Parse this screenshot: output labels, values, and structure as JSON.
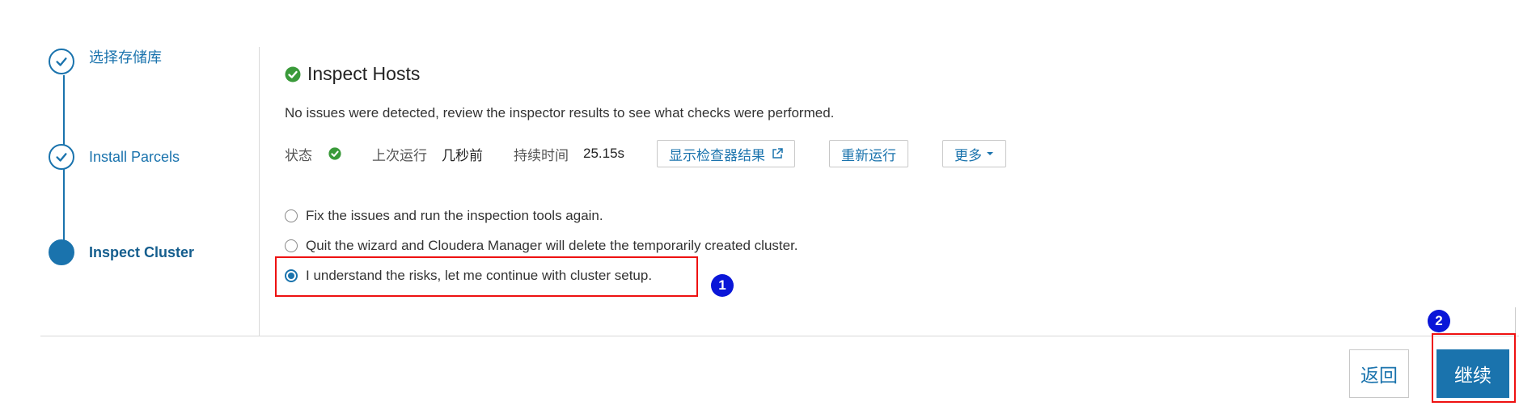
{
  "steps": [
    {
      "label": "选择存储库",
      "state": "done"
    },
    {
      "label": "Install Parcels",
      "state": "done"
    },
    {
      "label": "Inspect Cluster",
      "state": "current"
    }
  ],
  "main": {
    "title": "Inspect Hosts",
    "description": "No issues were detected, review the inspector results to see what checks were performed.",
    "status": {
      "status_label": "状态",
      "last_run_label": "上次运行",
      "last_run_value": "几秒前",
      "duration_label": "持续时间",
      "duration_value": "25.15s"
    },
    "buttons": {
      "show_results": "显示检查器结果",
      "rerun": "重新运行",
      "more": "更多"
    },
    "options": [
      {
        "label": "Fix the issues and run the inspection tools again.",
        "checked": false
      },
      {
        "label": "Quit the wizard and Cloudera Manager will delete the temporarily created cluster.",
        "checked": false
      },
      {
        "label": "I understand the risks, let me continue with cluster setup.",
        "checked": true
      }
    ]
  },
  "annotations": {
    "badge1": "1",
    "badge2": "2"
  },
  "footer": {
    "back_label": "返回",
    "continue_label": "继续"
  },
  "colors": {
    "accent": "#1a73ad",
    "success": "#3a9a3a",
    "highlight": "#e11111",
    "badge": "#0a16d8"
  }
}
